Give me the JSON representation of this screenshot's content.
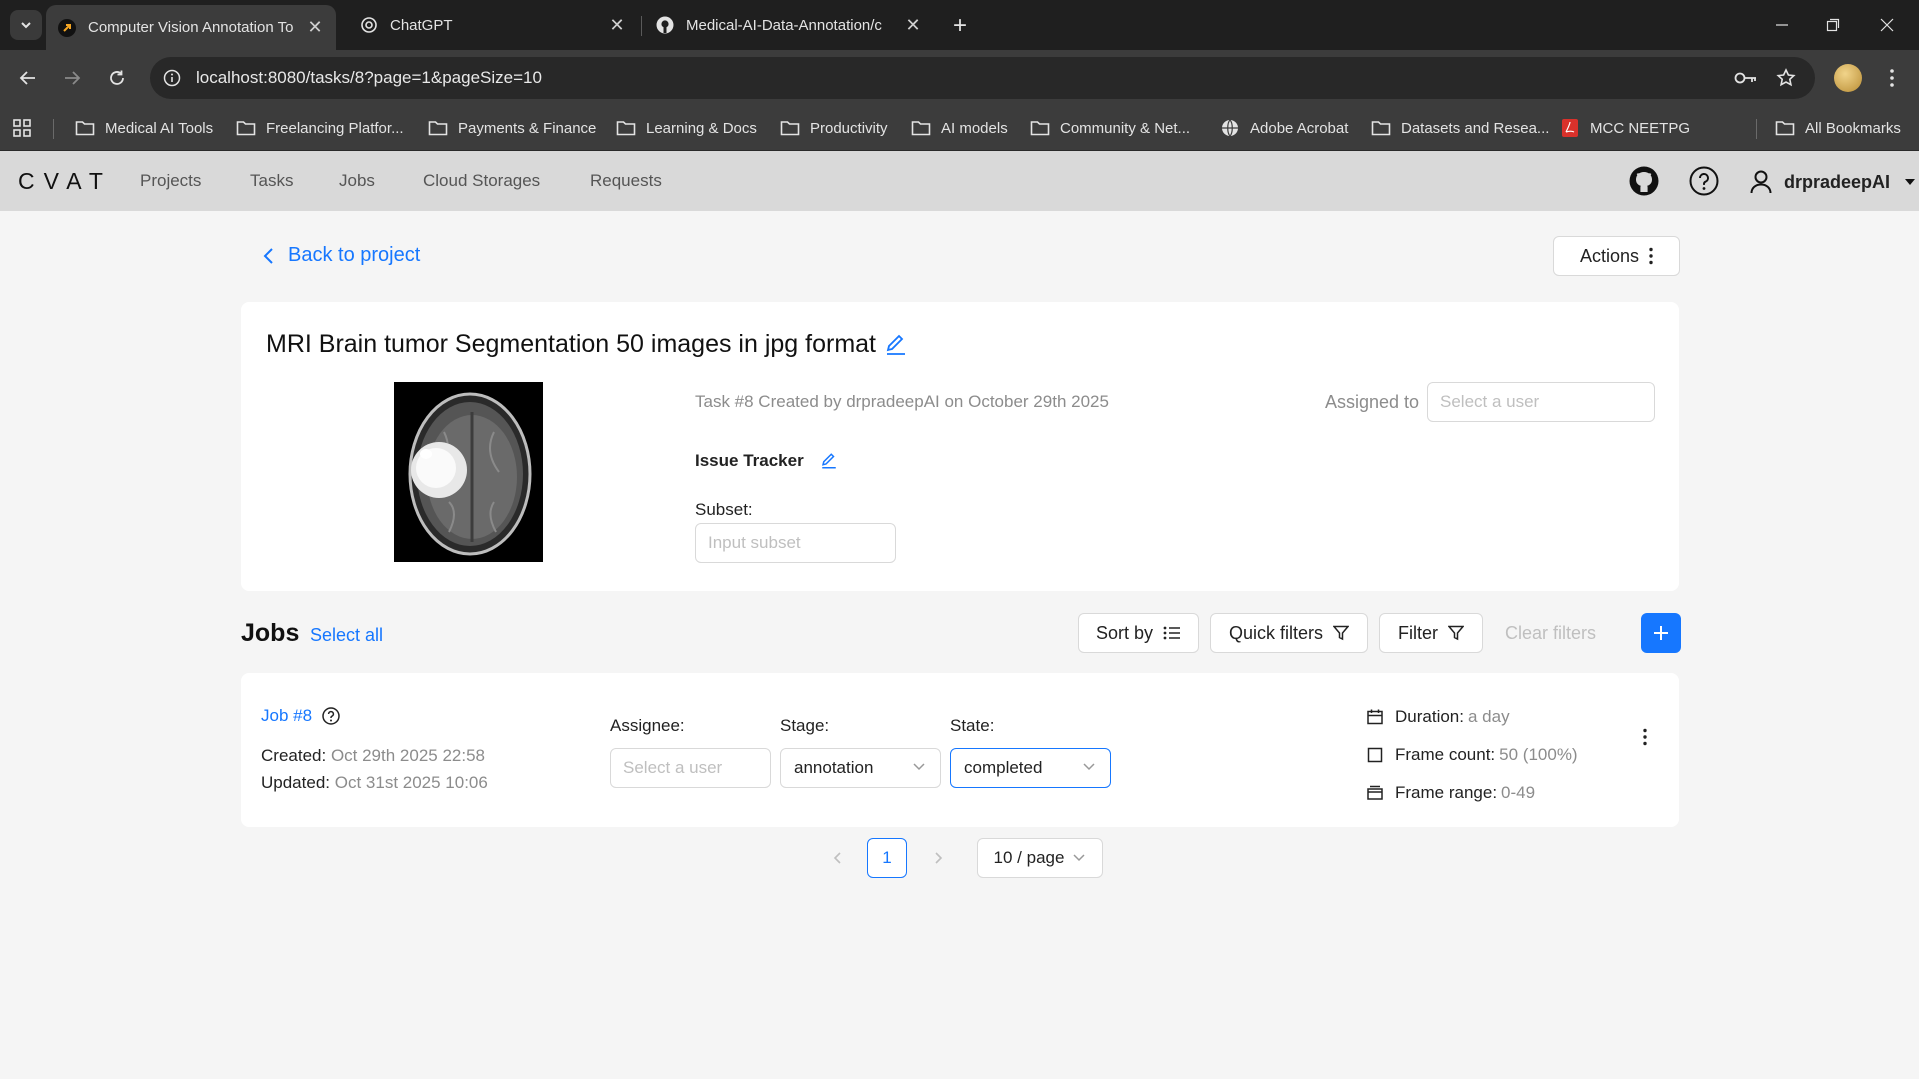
{
  "browser": {
    "tabs": [
      {
        "title": "Computer Vision Annotation To",
        "active": true
      },
      {
        "title": "ChatGPT",
        "active": false
      },
      {
        "title": "Medical-AI-Data-Annotation/c",
        "active": false
      }
    ],
    "url": "localhost:8080/tasks/8?page=1&pageSize=10",
    "bookmarks": [
      "Medical AI Tools",
      "Freelancing Platfor...",
      "Payments & Finance",
      "Learning & Docs",
      "Productivity",
      "AI models",
      "Community & Net...",
      "Adobe Acrobat",
      "Datasets and Resea...",
      "MCC NEETPG"
    ],
    "all_bookmarks": "All Bookmarks"
  },
  "app": {
    "logo": "CVAT",
    "nav": [
      "Projects",
      "Tasks",
      "Jobs",
      "Cloud Storages",
      "Requests"
    ],
    "username": "drpradeepAI"
  },
  "page": {
    "back_label": "Back to project",
    "actions_label": "Actions"
  },
  "task": {
    "title": "MRI Brain tumor Segmentation 50 images in jpg format",
    "meta": "Task #8 Created by drpradeepAI on October 29th 2025",
    "assigned_label": "Assigned to",
    "assigned_placeholder": "Select a user",
    "issue_tracker_label": "Issue Tracker",
    "subset_label": "Subset:",
    "subset_placeholder": "Input subset"
  },
  "jobs": {
    "title": "Jobs",
    "select_all": "Select all",
    "sort_by": "Sort by",
    "quick_filters": "Quick filters",
    "filter": "Filter",
    "clear_filters": "Clear filters",
    "items": [
      {
        "id": "Job #8",
        "created_label": "Created:",
        "created": "Oct 29th 2025 22:58",
        "updated_label": "Updated:",
        "updated": "Oct 31st 2025 10:06",
        "assignee_label": "Assignee:",
        "assignee_placeholder": "Select a user",
        "stage_label": "Stage:",
        "stage": "annotation",
        "state_label": "State:",
        "state": "completed",
        "duration_label": "Duration:",
        "duration": "a day",
        "frame_count_label": "Frame count:",
        "frame_count": "50 (100%)",
        "frame_range_label": "Frame range:",
        "frame_range": "0-49"
      }
    ]
  },
  "pagination": {
    "current_page": "1",
    "page_size": "10 / page"
  },
  "colors": {
    "primary": "#1677ff",
    "header_bg": "#d9d9d9",
    "page_bg": "#f5f5f5"
  }
}
